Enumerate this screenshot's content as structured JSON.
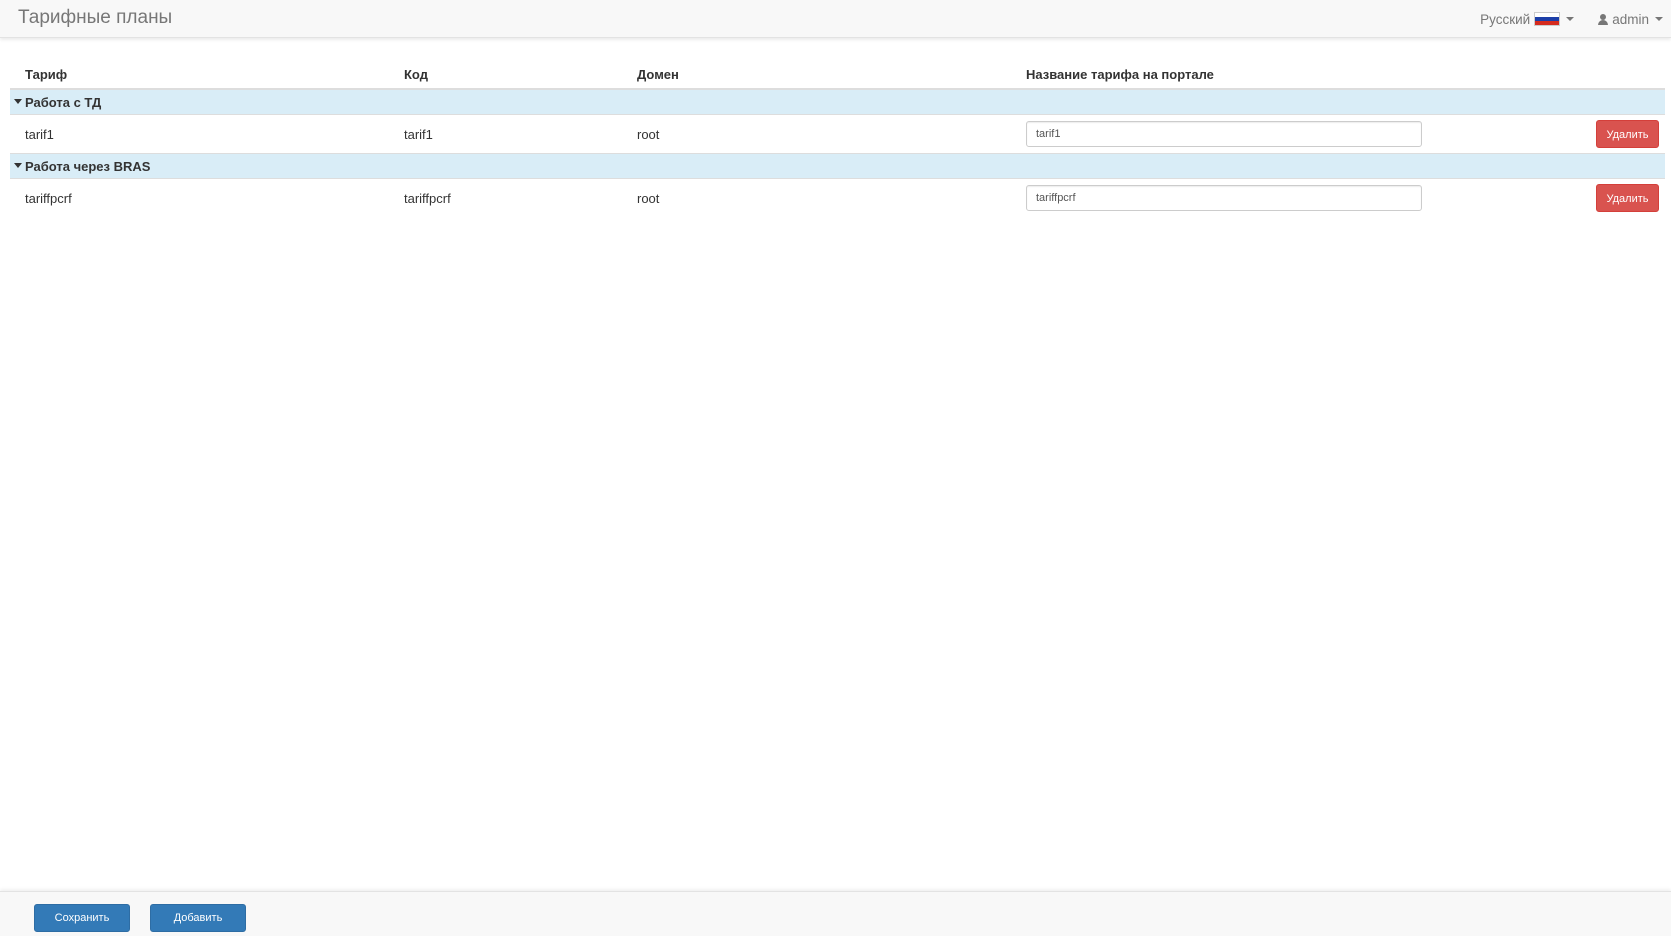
{
  "navbar": {
    "title": "Тарифные планы",
    "language": "Русский",
    "user": "admin"
  },
  "table": {
    "headers": {
      "tariff": "Тариф",
      "code": "Код",
      "domain": "Домен",
      "portal_name": "Название тарифа на портале"
    },
    "groups": [
      {
        "label": "Работа с ТД",
        "rows": [
          {
            "tariff": "tarif1",
            "code": "tarif1",
            "domain": "root",
            "portal_name": "tarif1",
            "delete_label": "Удалить"
          }
        ]
      },
      {
        "label": "Работа через BRAS",
        "rows": [
          {
            "tariff": "tariffpcrf",
            "code": "tariffpcrf",
            "domain": "root",
            "portal_name": "tariffpcrf",
            "delete_label": "Удалить"
          }
        ]
      }
    ]
  },
  "footer": {
    "save_label": "Сохранить",
    "add_label": "Добавить"
  },
  "colors": {
    "group_bg": "#d9edf7",
    "danger": "#d9534f",
    "primary": "#337ab7"
  },
  "icons": {
    "flag": "russia-flag-icon",
    "user": "user-icon",
    "caret": "caret-down-icon"
  }
}
